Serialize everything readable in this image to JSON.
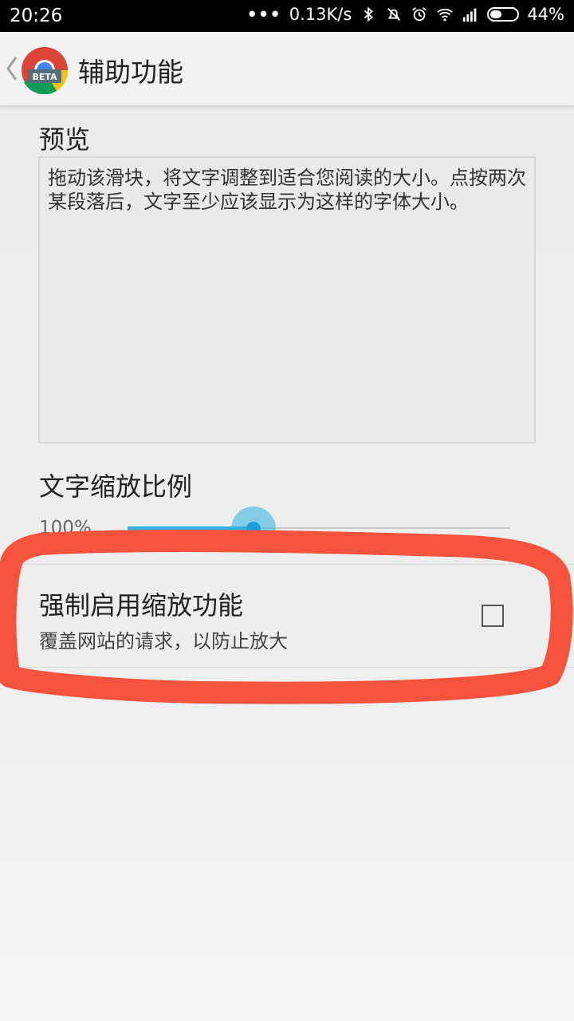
{
  "status_bar": {
    "time": "20:26",
    "network_speed": "0.13K/s",
    "battery_percent": "44%",
    "battery_level": 0.44,
    "icons": [
      "more-dots-icon",
      "bluetooth-icon",
      "mute-icon",
      "alarm-icon",
      "wifi-icon",
      "signal-icon",
      "battery-icon"
    ]
  },
  "app_bar": {
    "title": "辅助功能",
    "logo_badge": "BETA"
  },
  "preview": {
    "heading": "预览",
    "text": "拖动该滑块，将文字调整到适合您阅读的大小。点按两次某段落后，文字至少应该显示为这样的字体大小。"
  },
  "text_scale": {
    "heading": "文字缩放比例",
    "value_label": "100%",
    "slider_fraction": 0.33
  },
  "force_zoom": {
    "title": "强制启用缩放功能",
    "summary": "覆盖网站的请求，以防止放大",
    "checked": false
  },
  "colors": {
    "accent": "#2eb2e6",
    "annotation": "#f5533d"
  }
}
